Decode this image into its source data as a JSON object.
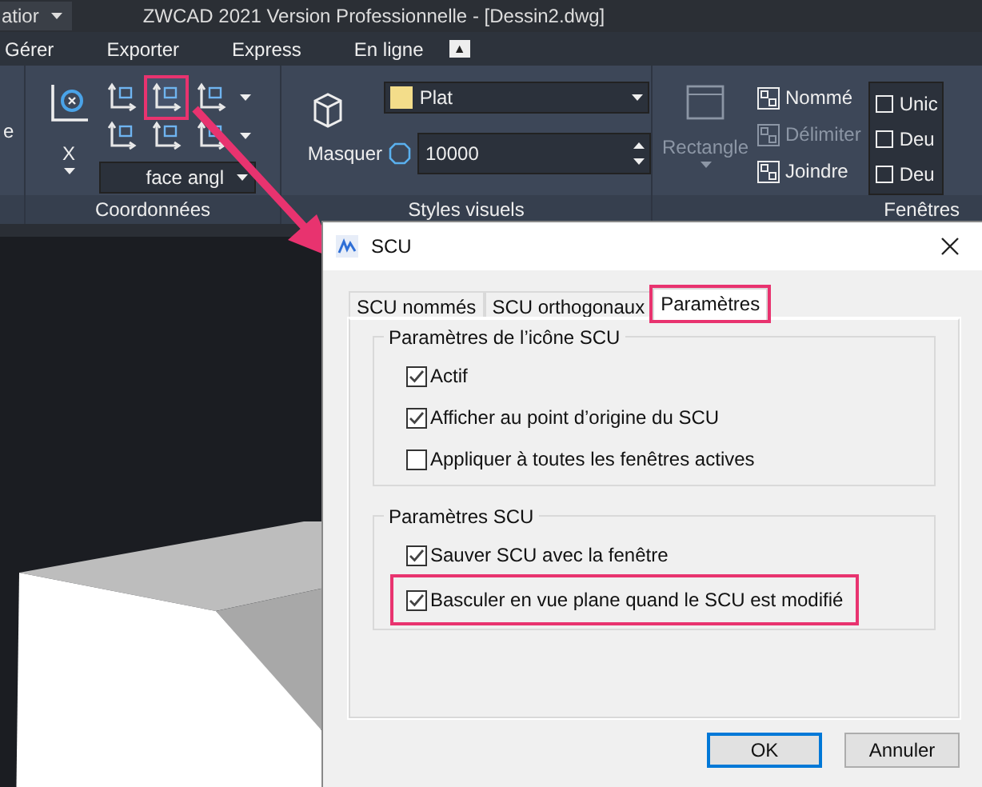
{
  "title_bar": {
    "workspace": "atior",
    "title": "ZWCAD 2021 Version Professionnelle - [Dessin2.dwg]"
  },
  "menu": {
    "items": [
      "Gérer",
      "Exporter",
      "Express",
      "En ligne"
    ],
    "collapse_symbol": "▲"
  },
  "ribbon": {
    "left_cut": "e",
    "coordinates": {
      "label": "Coordonnées",
      "big_button": "X",
      "tools": [
        {
          "highlighted": false
        },
        {
          "highlighted": true
        },
        {
          "highlighted": false
        },
        {
          "highlighted": false
        },
        {
          "highlighted": false
        },
        {
          "highlighted": false
        }
      ],
      "dropdown": "face angl"
    },
    "visual_styles": {
      "label": "Styles visuels",
      "hide_button": "Masquer",
      "style": "Plat",
      "value": "10000"
    },
    "viewports": {
      "label": "Fenêtres",
      "rectangle": {
        "label": "Rectangle",
        "disabled": true
      },
      "buttons": [
        {
          "label": "Nommé",
          "disabled": false
        },
        {
          "label": "Délimiter",
          "disabled": true
        },
        {
          "label": "Joindre",
          "disabled": false
        }
      ],
      "layouts": [
        "Unic",
        "Deu",
        "Deu"
      ]
    }
  },
  "dialog": {
    "title": "SCU",
    "tabs": [
      {
        "label": "SCU nommés",
        "selected": false,
        "highlighted": false
      },
      {
        "label": "SCU orthogonaux",
        "selected": false,
        "highlighted": false
      },
      {
        "label": "Paramètres",
        "selected": true,
        "highlighted": true
      }
    ],
    "groups": [
      {
        "title": "Paramètres de l’icône SCU",
        "options": [
          {
            "label": "Actif",
            "checked": true,
            "highlighted": false
          },
          {
            "label": "Afficher au point d’origine du SCU",
            "checked": true,
            "highlighted": false
          },
          {
            "label": "Appliquer à toutes les fenêtres actives",
            "checked": false,
            "highlighted": false
          }
        ]
      },
      {
        "title": "Paramètres SCU",
        "options": [
          {
            "label": "Sauver SCU avec la fenêtre",
            "checked": true,
            "highlighted": false
          },
          {
            "label": "Basculer en vue plane quand le SCU est modifié",
            "checked": true,
            "highlighted": true
          }
        ]
      }
    ],
    "buttons": [
      {
        "label": "OK",
        "default": true
      },
      {
        "label": "Annuler",
        "default": false
      }
    ]
  }
}
